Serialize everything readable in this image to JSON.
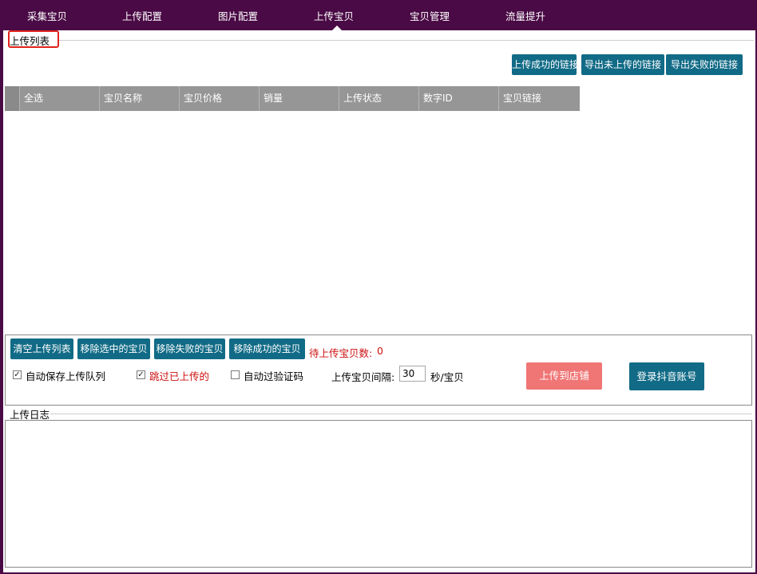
{
  "nav": {
    "tabs": [
      {
        "label": "采集宝贝"
      },
      {
        "label": "上传配置"
      },
      {
        "label": "图片配置"
      },
      {
        "label": "上传宝贝",
        "active": true
      },
      {
        "label": "宝贝管理"
      },
      {
        "label": "流量提升"
      }
    ]
  },
  "upload_list": {
    "title": "上传列表",
    "export_buttons": {
      "success": "上传成功的链接",
      "not_uploaded": "导出未上传的链接",
      "failed": "导出失败的链接"
    },
    "columns": [
      "全选",
      "宝贝名称",
      "宝贝价格",
      "销量",
      "上传状态",
      "数字ID",
      "宝贝链接"
    ],
    "rows": []
  },
  "controls": {
    "clear_list": "清空上传列表",
    "remove_selected": "移除选中的宝贝",
    "remove_failed": "移除失败的宝贝",
    "remove_success": "移除成功的宝贝",
    "pending_label": "待上传宝贝数:",
    "pending_count": "0",
    "auto_save_label": "自动保存上传队列",
    "auto_save_checked": true,
    "skip_uploaded_label": "跳过已上传的",
    "skip_uploaded_checked": true,
    "auto_captcha_label": "自动过验证码",
    "auto_captcha_checked": false,
    "interval_label": "上传宝贝间隔:",
    "interval_value": "30",
    "interval_unit": "秒/宝贝",
    "upload_to_store": "上传到店铺",
    "login_douyin": "登录抖音账号"
  },
  "log": {
    "title": "上传日志",
    "content": ""
  },
  "colors": {
    "background": "#4a0a45",
    "primary_button": "#116b86",
    "upload_button": "#f07575",
    "header_row": "#969696",
    "highlight_border": "#e0231c",
    "warning_text": "#cc1111"
  }
}
